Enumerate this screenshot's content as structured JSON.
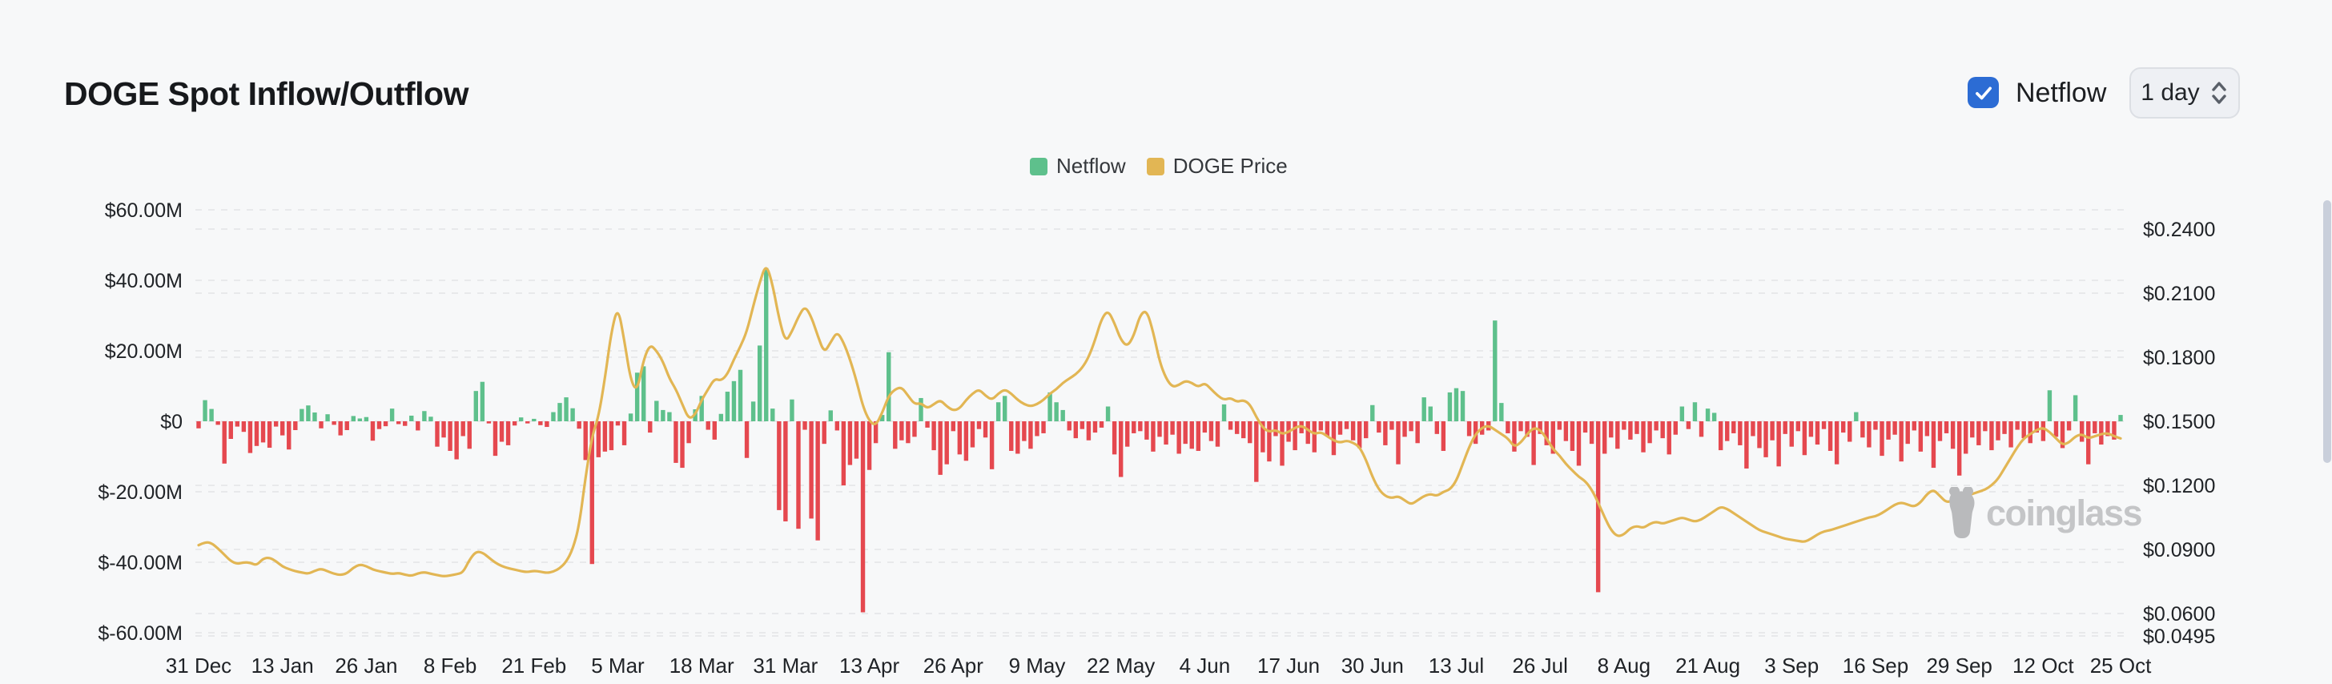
{
  "header": {
    "title": "DOGE Spot Inflow/Outflow",
    "netflow_toggle": {
      "label": "Netflow",
      "checked": true
    },
    "interval_select": {
      "value": "1 day"
    }
  },
  "legend": [
    {
      "label": "Netflow",
      "color": "#5ec08c"
    },
    {
      "label": "DOGE Price",
      "color": "#e2b654"
    }
  ],
  "watermark": {
    "text": "coinglass"
  },
  "colors": {
    "background": "#f7f8f9",
    "inflow_green": "#5ec08c",
    "outflow_red": "#e5484f",
    "price_gold": "#e2b654",
    "checkbox_blue": "#2c6cd4",
    "grid": "#e8e9eb",
    "axis_text": "#202327",
    "watermark_gray": "#c4c5c7",
    "scrollbar": "#c9cfdb"
  },
  "chart_data": {
    "type": "bar+line",
    "title": "DOGE Spot Inflow/Outflow",
    "grid": "dashed, both value axes",
    "legend_position": "top-center",
    "x_start": "31 Dec",
    "x_end": "25 Oct",
    "x_labels": [
      {
        "label": "31 Dec",
        "day": 0
      },
      {
        "label": "13 Jan",
        "day": 13
      },
      {
        "label": "26 Jan",
        "day": 26
      },
      {
        "label": "8 Feb",
        "day": 39
      },
      {
        "label": "21 Feb",
        "day": 52
      },
      {
        "label": "5 Mar",
        "day": 65
      },
      {
        "label": "18 Mar",
        "day": 78
      },
      {
        "label": "31 Mar",
        "day": 91
      },
      {
        "label": "13 Apr",
        "day": 104
      },
      {
        "label": "26 Apr",
        "day": 117
      },
      {
        "label": "9 May",
        "day": 130
      },
      {
        "label": "22 May",
        "day": 143
      },
      {
        "label": "4 Jun",
        "day": 156
      },
      {
        "label": "17 Jun",
        "day": 169
      },
      {
        "label": "30 Jun",
        "day": 182
      },
      {
        "label": "13 Jul",
        "day": 195
      },
      {
        "label": "26 Jul",
        "day": 208
      },
      {
        "label": "8 Aug",
        "day": 221
      },
      {
        "label": "21 Aug",
        "day": 234
      },
      {
        "label": "3 Sep",
        "day": 247
      },
      {
        "label": "16 Sep",
        "day": 260
      },
      {
        "label": "29 Sep",
        "day": 273
      },
      {
        "label": "12 Oct",
        "day": 286
      },
      {
        "label": "25 Oct",
        "day": 298
      }
    ],
    "left_axis": {
      "name": "Netflow (USD)",
      "range_musd": [
        -60,
        60
      ],
      "ticks": [
        {
          "label": "$60.00M",
          "value_musd": 60
        },
        {
          "label": "$40.00M",
          "value_musd": 40
        },
        {
          "label": "$20.00M",
          "value_musd": 20
        },
        {
          "label": "$0",
          "value_musd": 0
        },
        {
          "label": "$-20.00M",
          "value_musd": -20
        },
        {
          "label": "$-40.00M",
          "value_musd": -40
        },
        {
          "label": "$-60.00M",
          "value_musd": -60
        }
      ]
    },
    "right_axis": {
      "name": "DOGE Price (USD)",
      "range_usd": [
        0.0495,
        0.2505
      ],
      "ticks": [
        {
          "label": "$0.2400",
          "value": 0.24
        },
        {
          "label": "$0.2100",
          "value": 0.21
        },
        {
          "label": "$0.1800",
          "value": 0.18
        },
        {
          "label": "$0.1500",
          "value": 0.15
        },
        {
          "label": "$0.1200",
          "value": 0.12
        },
        {
          "label": "$0.0900",
          "value": 0.09
        },
        {
          "label": "$0.0600",
          "value": 0.06
        },
        {
          "label": "$0.0495",
          "value": 0.0495
        }
      ]
    },
    "series": [
      {
        "name": "Netflow",
        "type": "bar",
        "unit": "million USD per day",
        "color_positive": "#5ec08c",
        "color_negative": "#e5484f",
        "values_musd": [
          -2,
          6,
          3.5,
          -1,
          -12,
          -5,
          -1.5,
          -3,
          -9,
          -7,
          -6,
          -7.5,
          -1.5,
          -4,
          -8,
          -2.5,
          3.5,
          4.5,
          2.5,
          -2,
          2,
          -1,
          -4,
          -2.5,
          1.5,
          0.8,
          1.2,
          -5.5,
          -2.2,
          -1.4,
          3.6,
          -0.8,
          -1.3,
          1.6,
          -2.6,
          2.9,
          1.3,
          -7.2,
          -4.6,
          -8.4,
          -10.8,
          -4.2,
          -7.8,
          8.6,
          11.2,
          -0.6,
          -9.8,
          -5.8,
          -6.8,
          -1.2,
          1.1,
          -0.6,
          0.7,
          -1.1,
          -1.6,
          2.6,
          5.2,
          6.8,
          3.7,
          -2.1,
          -11,
          -40.5,
          -10.2,
          -8.6,
          -8.2,
          -1.2,
          -6.8,
          2.2,
          13.8,
          15.6,
          -3.2,
          5.8,
          3.2,
          2.6,
          -11.8,
          -13.2,
          -6.2,
          3.4,
          7.2,
          -2.4,
          -5.2,
          2.1,
          8.4,
          11.4,
          14.6,
          -10.4,
          5.6,
          21.5,
          43.5,
          3.6,
          -25.2,
          -28.4,
          6.2,
          -30.5,
          -2.4,
          -27.6,
          -33.8,
          -6.4,
          3.1,
          -2.6,
          -18.2,
          -12.4,
          -10.6,
          -54.2,
          -13.8,
          -6.2,
          1.8,
          19.6,
          -7.8,
          -5.4,
          -6.2,
          -4.4,
          6.6,
          -1.8,
          -8.2,
          -15.2,
          -12.2,
          -2.8,
          -9.4,
          -11.2,
          -7.4,
          -2.2,
          -4.6,
          -13.6,
          5.4,
          7.2,
          -8.4,
          -9.2,
          -5.6,
          -7.8,
          -4.2,
          -3.4,
          8.2,
          5.4,
          3.2,
          -2.6,
          -4.8,
          -2.2,
          -5.4,
          -3.2,
          -1.8,
          4.2,
          -9.4,
          -15.8,
          -7.2,
          -3.4,
          -2.8,
          -5.2,
          -8.6,
          -4.4,
          -6.6,
          -3.8,
          -9.2,
          -6.4,
          -7.8,
          -8.4,
          -3.2,
          -5.6,
          -7.2,
          4.8,
          -2.4,
          -3.6,
          -4.8,
          -6.2,
          -17.2,
          -8.8,
          -11.4,
          -4.2,
          -12.6,
          -5.8,
          -8.2,
          -3.4,
          -6.4,
          -8.8,
          -2.6,
          -4.2,
          -9.6,
          -3.8,
          -2.2,
          -5.4,
          -7.6,
          -4.8,
          4.6,
          -3.2,
          -6.8,
          -2.4,
          -12.2,
          -4.4,
          -2.8,
          -6.2,
          6.8,
          4.2,
          -3.6,
          -8.4,
          8.2,
          9.4,
          8.6,
          -4.2,
          -6.4,
          -3.8,
          -2.6,
          28.6,
          5.2,
          -3.4,
          -8.6,
          -2.8,
          -4.4,
          -12.4,
          -3.6,
          -6.8,
          -9.2,
          -2.4,
          -5.6,
          -8.4,
          -12.6,
          -3.2,
          -6.4,
          -48.5,
          -9.2,
          -4.6,
          -7.8,
          -2.4,
          -5.2,
          -3.6,
          -8.8,
          -6.2,
          -2.6,
          -4.8,
          -9.4,
          -3.8,
          4.2,
          -2.2,
          5.4,
          -4.4,
          3.6,
          2.4,
          -8.2,
          -5.6,
          -3.4,
          -6.8,
          -13.4,
          -4.2,
          -7.6,
          -10.2,
          -5.4,
          -12.8,
          -3.6,
          -7.2,
          -2.8,
          -9.6,
          -4.4,
          -6.6,
          -2.2,
          -8.4,
          -12.2,
          -3.2,
          -5.8,
          2.6,
          -4.6,
          -7.4,
          -2.4,
          -9.8,
          -5.2,
          -3.8,
          -11.4,
          -6.4,
          -2.6,
          -8.6,
          -4.2,
          -13.2,
          -5.6,
          -3.4,
          -7.8,
          -15.4,
          -9.2,
          -4.6,
          -6.8,
          -2.8,
          -8.2,
          -5.4,
          -3.6,
          -7.4,
          -2.4,
          -4.8,
          -6.2,
          -3.2,
          -5.6,
          8.8,
          -4.4,
          -7.6,
          -2.6,
          7.4,
          -5.8,
          -12.2,
          -3.4,
          -6.6,
          -4.2,
          -5.2,
          1.8
        ]
      },
      {
        "name": "DOGE Price",
        "type": "line",
        "unit": "USD",
        "color": "#e2b654",
        "values_usd": [
          0.092,
          0.0935,
          0.093,
          0.0905,
          0.0875,
          0.0845,
          0.0832,
          0.084,
          0.0838,
          0.0825,
          0.0858,
          0.0862,
          0.0845,
          0.082,
          0.0808,
          0.0798,
          0.0792,
          0.0786,
          0.08,
          0.081,
          0.0798,
          0.0786,
          0.078,
          0.0788,
          0.0815,
          0.083,
          0.0822,
          0.0806,
          0.0798,
          0.0792,
          0.0785,
          0.079,
          0.0782,
          0.0776,
          0.0788,
          0.0794,
          0.0786,
          0.078,
          0.0774,
          0.0778,
          0.0784,
          0.0792,
          0.0852,
          0.089,
          0.0886,
          0.0862,
          0.0838,
          0.0822,
          0.0812,
          0.0806,
          0.0798,
          0.0794,
          0.08,
          0.0796,
          0.079,
          0.0796,
          0.0812,
          0.0842,
          0.09,
          0.101,
          0.124,
          0.143,
          0.152,
          0.17,
          0.192,
          0.204,
          0.188,
          0.169,
          0.164,
          0.179,
          0.186,
          0.183,
          0.178,
          0.17,
          0.165,
          0.158,
          0.151,
          0.153,
          0.16,
          0.165,
          0.17,
          0.169,
          0.172,
          0.179,
          0.185,
          0.192,
          0.204,
          0.215,
          0.224,
          0.214,
          0.198,
          0.187,
          0.192,
          0.199,
          0.204,
          0.199,
          0.19,
          0.182,
          0.187,
          0.192,
          0.187,
          0.179,
          0.169,
          0.157,
          0.15,
          0.148,
          0.154,
          0.162,
          0.165,
          0.166,
          0.162,
          0.158,
          0.1585,
          0.156,
          0.158,
          0.16,
          0.157,
          0.155,
          0.156,
          0.16,
          0.163,
          0.165,
          0.162,
          0.16,
          0.163,
          0.165,
          0.163,
          0.16,
          0.158,
          0.157,
          0.158,
          0.16,
          0.163,
          0.165,
          0.168,
          0.17,
          0.172,
          0.175,
          0.18,
          0.188,
          0.198,
          0.202,
          0.196,
          0.188,
          0.185,
          0.19,
          0.2,
          0.202,
          0.192,
          0.178,
          0.17,
          0.166,
          0.167,
          0.169,
          0.168,
          0.166,
          0.168,
          0.165,
          0.162,
          0.16,
          0.161,
          0.159,
          0.16,
          0.158,
          0.152,
          0.147,
          0.145,
          0.146,
          0.144,
          0.145,
          0.147,
          0.148,
          0.146,
          0.144,
          0.145,
          0.143,
          0.141,
          0.14,
          0.141,
          0.14,
          0.138,
          0.132,
          0.124,
          0.118,
          0.115,
          0.114,
          0.115,
          0.113,
          0.111,
          0.113,
          0.115,
          0.116,
          0.115,
          0.117,
          0.118,
          0.122,
          0.13,
          0.138,
          0.144,
          0.147,
          0.148,
          0.146,
          0.144,
          0.142,
          0.138,
          0.14,
          0.144,
          0.147,
          0.146,
          0.142,
          0.137,
          0.134,
          0.13,
          0.127,
          0.124,
          0.122,
          0.118,
          0.112,
          0.105,
          0.099,
          0.096,
          0.097,
          0.1,
          0.101,
          0.1,
          0.102,
          0.103,
          0.102,
          0.103,
          0.104,
          0.105,
          0.104,
          0.103,
          0.104,
          0.106,
          0.108,
          0.11,
          0.109,
          0.107,
          0.105,
          0.103,
          0.101,
          0.099,
          0.098,
          0.097,
          0.096,
          0.095,
          0.0945,
          0.094,
          0.0935,
          0.095,
          0.097,
          0.0985,
          0.099,
          0.1,
          0.101,
          0.102,
          0.103,
          0.104,
          0.105,
          0.1055,
          0.107,
          0.109,
          0.111,
          0.112,
          0.111,
          0.11,
          0.112,
          0.116,
          0.118,
          0.115,
          0.112,
          0.113,
          0.114,
          0.115,
          0.116,
          0.117,
          0.118,
          0.12,
          0.123,
          0.128,
          0.133,
          0.138,
          0.142,
          0.144,
          0.146,
          0.147,
          0.145,
          0.142,
          0.139,
          0.14,
          0.143,
          0.144,
          0.142,
          0.143,
          0.144,
          0.1445,
          0.143,
          0.142
        ]
      }
    ]
  }
}
